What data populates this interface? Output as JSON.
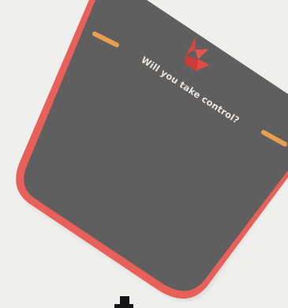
{
  "screen": {
    "caption": "Will you take control?",
    "logo_icon": "origami-bird-icon",
    "colors": {
      "background": "#ececea",
      "phone_frame": "#e8605a",
      "phone_screen": "#5f5f5f",
      "side_buttons": "#e8a050",
      "logo": "#e24a43"
    }
  }
}
